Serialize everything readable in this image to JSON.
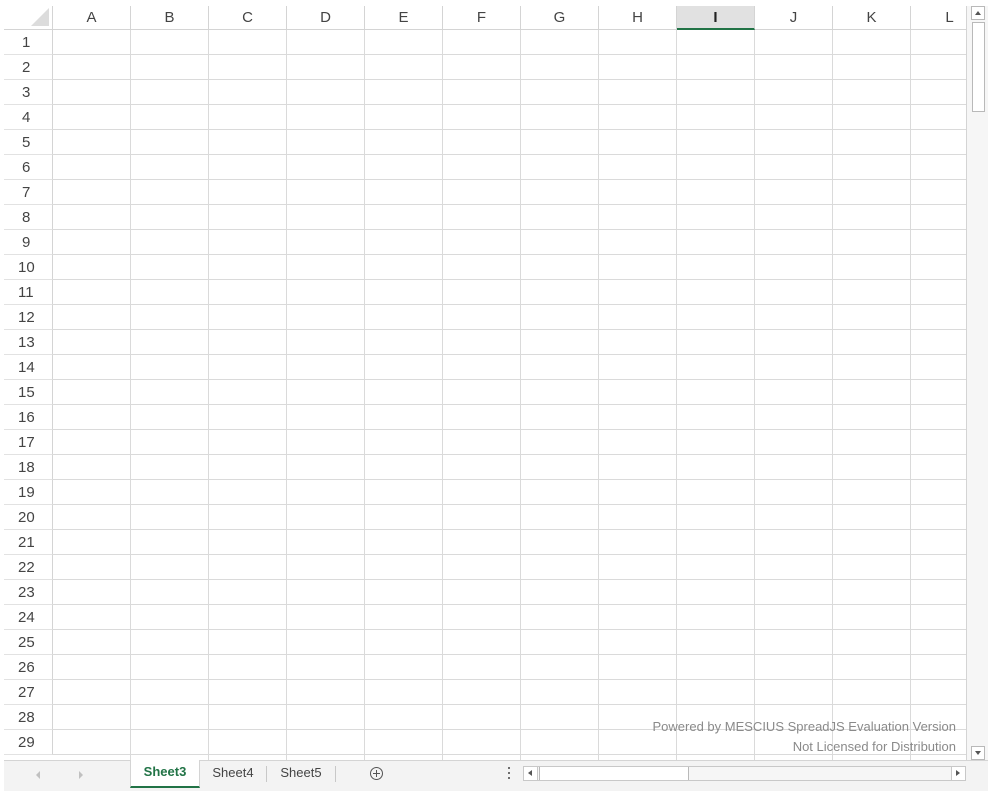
{
  "spreadsheet": {
    "columns": [
      "A",
      "B",
      "C",
      "D",
      "E",
      "F",
      "G",
      "H",
      "I",
      "J",
      "K",
      "L"
    ],
    "selected_column": "I",
    "rows": [
      "1",
      "2",
      "3",
      "4",
      "5",
      "6",
      "7",
      "8",
      "9",
      "10",
      "11",
      "12",
      "13",
      "14",
      "15",
      "16",
      "17",
      "18",
      "19",
      "20",
      "21",
      "22",
      "23",
      "24",
      "25",
      "26",
      "27",
      "28",
      "29"
    ]
  },
  "watermark": {
    "line1": "Powered by MESCIUS SpreadJS Evaluation Version",
    "line2": "Not Licensed for Distribution"
  },
  "sheet_tabs": [
    {
      "label": "Sheet3",
      "active": true
    },
    {
      "label": "Sheet4",
      "active": false
    },
    {
      "label": "Sheet5",
      "active": false
    }
  ],
  "icons": {
    "add_sheet": "plus-circle-icon",
    "more": "vertical-ellipsis-icon",
    "tab_prev": "chevron-left-icon",
    "tab_next": "chevron-right-icon",
    "scroll_up": "arrow-up-icon",
    "scroll_down": "arrow-down-icon",
    "scroll_left": "arrow-left-icon",
    "scroll_right": "arrow-right-icon"
  },
  "colors": {
    "accent": "#217346",
    "gridline": "#dadada",
    "selected_header_bg": "#e1e1e1"
  }
}
